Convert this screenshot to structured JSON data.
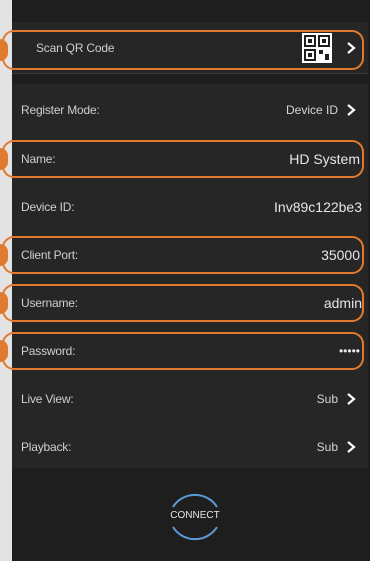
{
  "rows": [
    {
      "label": "Scan QR Code"
    },
    {
      "label": "Register Mode:",
      "value": "Device ID"
    },
    {
      "label": "Name:",
      "value": "HD System"
    },
    {
      "label": "Device ID:",
      "value": "Inv89c122be3"
    },
    {
      "label": "Client Port:",
      "value": "35000"
    },
    {
      "label": "Username:",
      "value": "admin"
    },
    {
      "label": "Password:",
      "value": "•••••"
    },
    {
      "label": "Live View:",
      "value": "Sub"
    },
    {
      "label": "Playback:",
      "value": "Sub"
    }
  ],
  "connect_label": "CONNECT",
  "colors": {
    "highlight": "#e07a2e",
    "background": "#1e1e1e",
    "row": "#262626"
  },
  "icons": {
    "qr": "qr-code-icon",
    "chevron": "chevron-right-icon"
  }
}
